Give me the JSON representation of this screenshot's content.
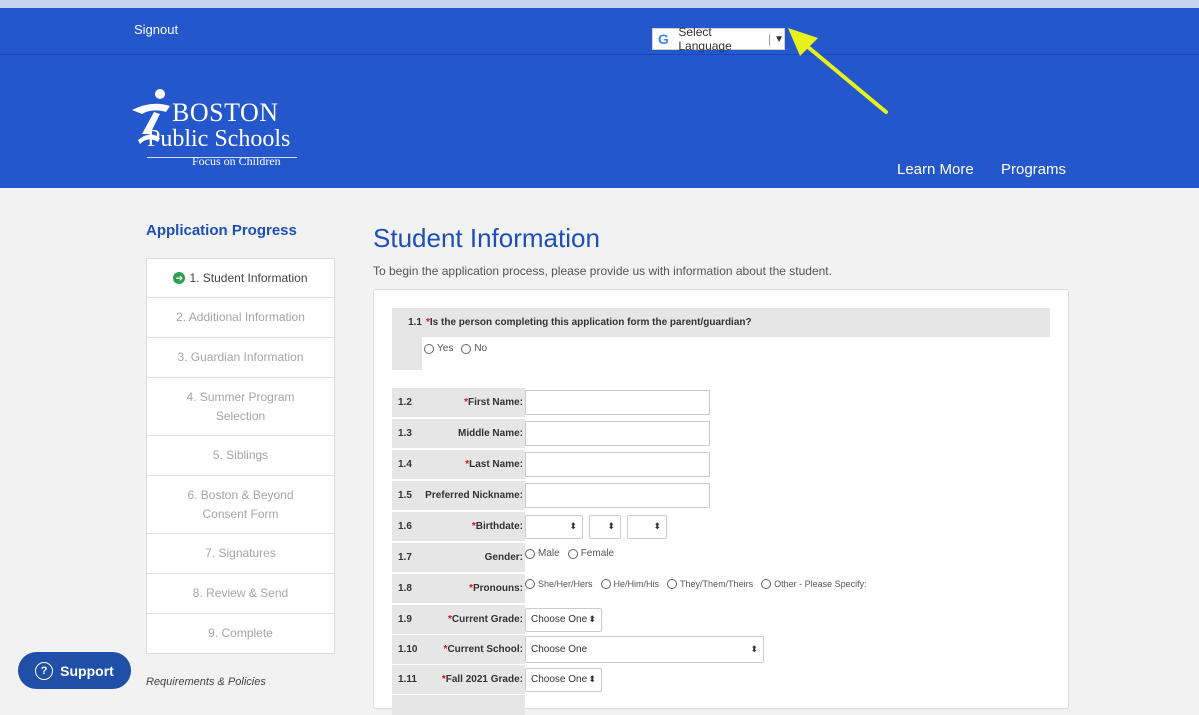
{
  "header": {
    "signout": "Signout",
    "language": {
      "g_icon": "G",
      "label": "Select Language",
      "arrow": "▼"
    },
    "logo": {
      "line1": "BOSTON",
      "line2": "Public Schools",
      "line3": "Focus on Children"
    },
    "nav": [
      "Learn More",
      "Programs"
    ]
  },
  "sidebar": {
    "title": "Application Progress",
    "steps": [
      "1. Student Information",
      "2. Additional Information",
      "3. Guardian Information",
      "4. Summer Program Selection",
      "5. Siblings",
      "6. Boston & Beyond Consent Form",
      "7. Signatures",
      "8. Review & Send",
      "9. Complete"
    ],
    "active_step": 0,
    "requirements": "Requirements & Policies"
  },
  "support": {
    "icon": "?",
    "label": "Support"
  },
  "main": {
    "title": "Student Information",
    "intro": "To begin the application process, please provide us with information about the student.",
    "q11": {
      "num": "1.1",
      "star": "*",
      "text": "Is the person completing this application form the parent/guardian?",
      "options": [
        "Yes",
        "No"
      ]
    },
    "fields": [
      {
        "num": "1.2",
        "star": "*",
        "label": "First Name:",
        "type": "text"
      },
      {
        "num": "1.3",
        "star": "",
        "label": "Middle Name:",
        "type": "text"
      },
      {
        "num": "1.4",
        "star": "*",
        "label": "Last Name:",
        "type": "text"
      },
      {
        "num": "1.5",
        "star": "",
        "label": "Preferred Nickname:",
        "type": "text"
      },
      {
        "num": "1.6",
        "star": "*",
        "label": "Birthdate:",
        "type": "date"
      },
      {
        "num": "1.7",
        "star": "",
        "label": "Gender:",
        "type": "radio",
        "options": [
          "Male",
          "Female"
        ]
      },
      {
        "num": "1.8",
        "star": "*",
        "label": "Pronouns:",
        "type": "radio",
        "options": [
          "She/Her/Hers",
          "He/Him/His",
          "They/Them/Theirs",
          "Other - Please Specify:"
        ]
      },
      {
        "num": "1.9",
        "star": "*",
        "label": "Current Grade:",
        "type": "select",
        "value": "Choose One"
      },
      {
        "num": "1.10",
        "star": "*",
        "label": "Current School:",
        "type": "select-wide",
        "value": "Choose One"
      },
      {
        "num": "1.11",
        "star": "*",
        "label": "Fall 2021 Grade:",
        "type": "select",
        "value": "Choose One"
      }
    ]
  },
  "colors": {
    "header": "#2456cc",
    "title": "#1e4fb8",
    "star": "#d11",
    "support": "#1f4fa6",
    "arrow": "#e8f21a"
  },
  "icons": [
    "google-g-icon",
    "check-circle-icon",
    "help-circle-icon",
    "annotation-arrow-icon",
    "stepper-icon"
  ]
}
